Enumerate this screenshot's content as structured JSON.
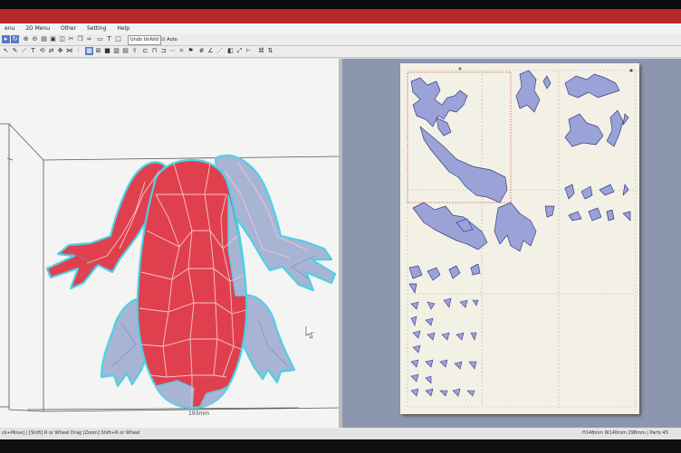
{
  "menu": [
    "enu",
    "2D Menu",
    "Other",
    "Setting",
    "Help"
  ],
  "toolbar": {
    "undo_label": "Undo Unfold",
    "auto_label": "Auto"
  },
  "view3d": {
    "dimension_label": "193mm"
  },
  "status": {
    "left": "ck+Move] | [Shift] R or Wheel Drag [Zoom] Shift+R or Wheel",
    "right": "H148mm W140mm 298mm | Parts 45"
  },
  "colors": {
    "frog_red": "#e0404e",
    "frog_blue": "#a8b4d4",
    "outline": "#4fd0e6",
    "part_fill": "#9aa2d8",
    "part_edge": "#3a3f86",
    "paper": "#f3f1e6",
    "workspace_2d": "#8c96ae",
    "title_bar": "#b72a2a"
  }
}
